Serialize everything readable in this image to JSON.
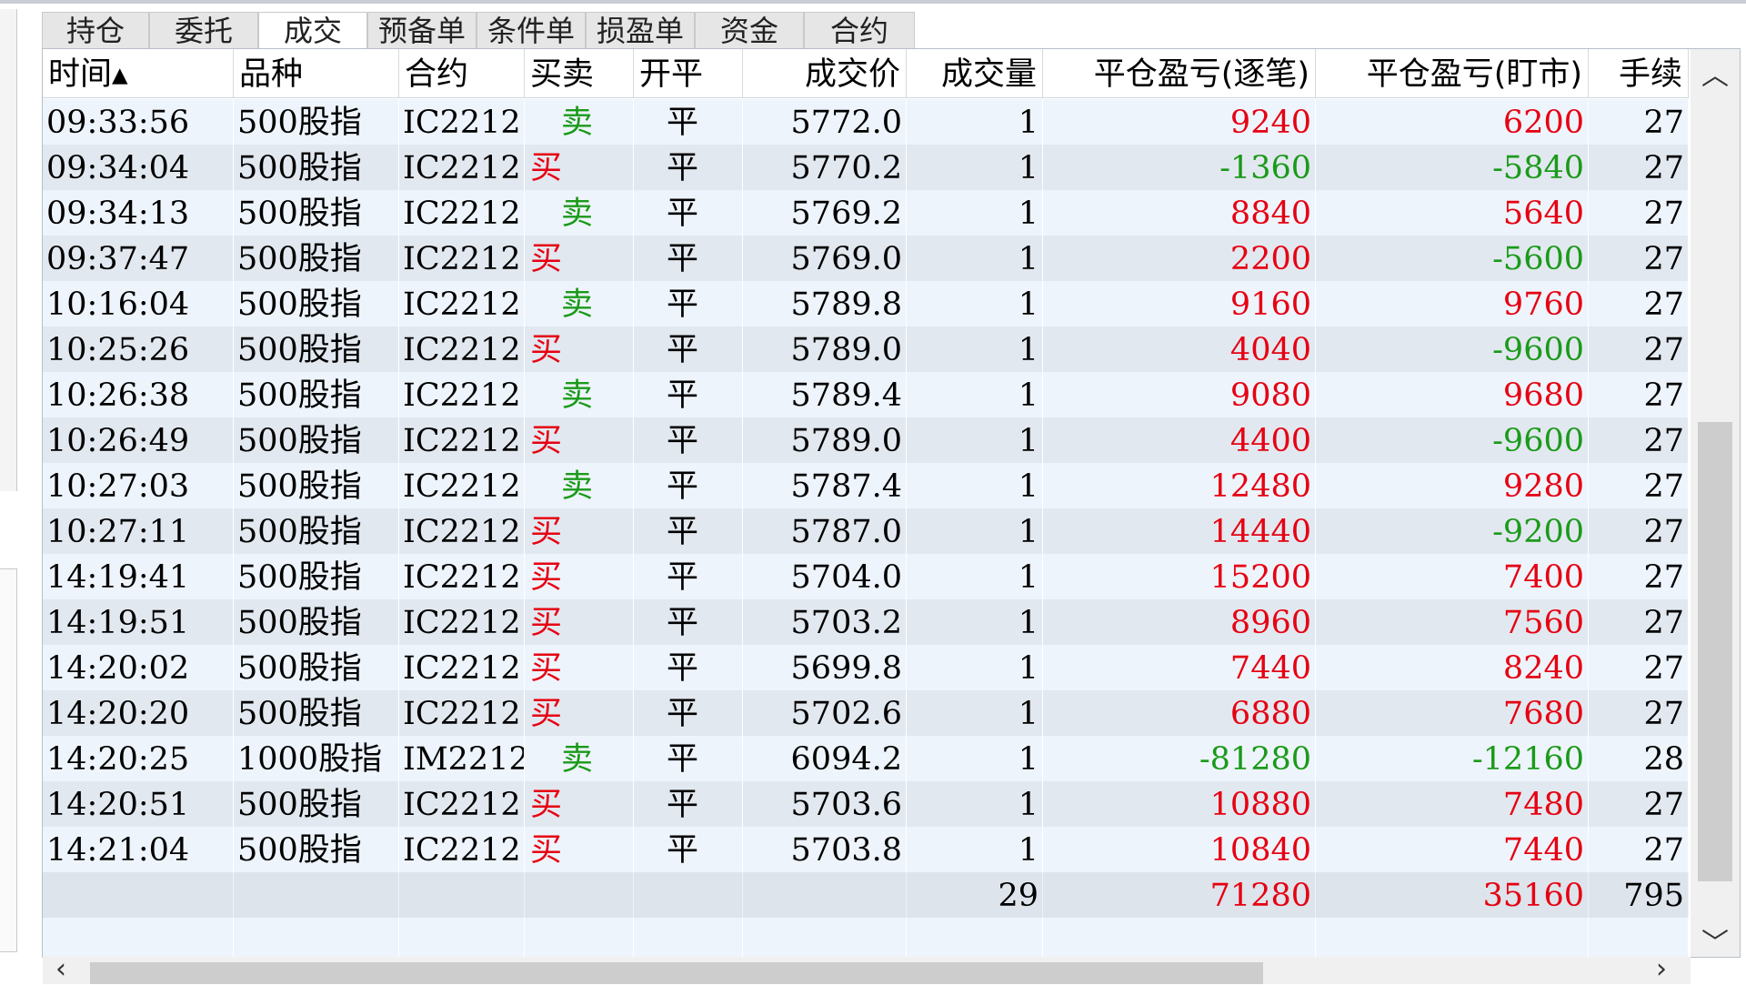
{
  "tabs": [
    {
      "label": "持仓",
      "w": 118
    },
    {
      "label": "委托",
      "w": 120
    },
    {
      "label": "成交",
      "w": 120,
      "active": true
    },
    {
      "label": "预备单",
      "w": 120
    },
    {
      "label": "条件单",
      "w": 120
    },
    {
      "label": "损盈单",
      "w": 120
    },
    {
      "label": "资金",
      "w": 120
    },
    {
      "label": "合约",
      "w": 122
    }
  ],
  "columns": [
    {
      "label": "时间▴",
      "w": 210,
      "align": "l"
    },
    {
      "label": "品种",
      "w": 182,
      "align": "l"
    },
    {
      "label": "合约",
      "w": 138,
      "align": "l"
    },
    {
      "label": "买卖",
      "w": 120,
      "align": "l"
    },
    {
      "label": "开平",
      "w": 120,
      "align": "l"
    },
    {
      "label": "成交价",
      "w": 180,
      "align": "r"
    },
    {
      "label": "成交量",
      "w": 150,
      "align": "r"
    },
    {
      "label": "平仓盈亏(逐笔)",
      "w": 300,
      "align": "r"
    },
    {
      "label": "平仓盈亏(盯市)",
      "w": 300,
      "align": "r"
    },
    {
      "label": "手续",
      "w": 110,
      "align": "r"
    }
  ],
  "rows": [
    {
      "time": "09:33:56",
      "product": "500股指",
      "contract": "IC2212",
      "side": "卖",
      "oc": "平",
      "price": "5772.0",
      "qty": "1",
      "pnl_trade": "9240",
      "pnl_mtm": "6200",
      "fee": "27"
    },
    {
      "time": "09:34:04",
      "product": "500股指",
      "contract": "IC2212",
      "side": "买",
      "oc": "平",
      "price": "5770.2",
      "qty": "1",
      "pnl_trade": "-1360",
      "pnl_mtm": "-5840",
      "fee": "27"
    },
    {
      "time": "09:34:13",
      "product": "500股指",
      "contract": "IC2212",
      "side": "卖",
      "oc": "平",
      "price": "5769.2",
      "qty": "1",
      "pnl_trade": "8840",
      "pnl_mtm": "5640",
      "fee": "27"
    },
    {
      "time": "09:37:47",
      "product": "500股指",
      "contract": "IC2212",
      "side": "买",
      "oc": "平",
      "price": "5769.0",
      "qty": "1",
      "pnl_trade": "2200",
      "pnl_mtm": "-5600",
      "fee": "27"
    },
    {
      "time": "10:16:04",
      "product": "500股指",
      "contract": "IC2212",
      "side": "卖",
      "oc": "平",
      "price": "5789.8",
      "qty": "1",
      "pnl_trade": "9160",
      "pnl_mtm": "9760",
      "fee": "27"
    },
    {
      "time": "10:25:26",
      "product": "500股指",
      "contract": "IC2212",
      "side": "买",
      "oc": "平",
      "price": "5789.0",
      "qty": "1",
      "pnl_trade": "4040",
      "pnl_mtm": "-9600",
      "fee": "27"
    },
    {
      "time": "10:26:38",
      "product": "500股指",
      "contract": "IC2212",
      "side": "卖",
      "oc": "平",
      "price": "5789.4",
      "qty": "1",
      "pnl_trade": "9080",
      "pnl_mtm": "9680",
      "fee": "27"
    },
    {
      "time": "10:26:49",
      "product": "500股指",
      "contract": "IC2212",
      "side": "买",
      "oc": "平",
      "price": "5789.0",
      "qty": "1",
      "pnl_trade": "4400",
      "pnl_mtm": "-9600",
      "fee": "27"
    },
    {
      "time": "10:27:03",
      "product": "500股指",
      "contract": "IC2212",
      "side": "卖",
      "oc": "平",
      "price": "5787.4",
      "qty": "1",
      "pnl_trade": "12480",
      "pnl_mtm": "9280",
      "fee": "27"
    },
    {
      "time": "10:27:11",
      "product": "500股指",
      "contract": "IC2212",
      "side": "买",
      "oc": "平",
      "price": "5787.0",
      "qty": "1",
      "pnl_trade": "14440",
      "pnl_mtm": "-9200",
      "fee": "27"
    },
    {
      "time": "14:19:41",
      "product": "500股指",
      "contract": "IC2212",
      "side": "买",
      "oc": "平",
      "price": "5704.0",
      "qty": "1",
      "pnl_trade": "15200",
      "pnl_mtm": "7400",
      "fee": "27"
    },
    {
      "time": "14:19:51",
      "product": "500股指",
      "contract": "IC2212",
      "side": "买",
      "oc": "平",
      "price": "5703.2",
      "qty": "1",
      "pnl_trade": "8960",
      "pnl_mtm": "7560",
      "fee": "27"
    },
    {
      "time": "14:20:02",
      "product": "500股指",
      "contract": "IC2212",
      "side": "买",
      "oc": "平",
      "price": "5699.8",
      "qty": "1",
      "pnl_trade": "7440",
      "pnl_mtm": "8240",
      "fee": "27"
    },
    {
      "time": "14:20:20",
      "product": "500股指",
      "contract": "IC2212",
      "side": "买",
      "oc": "平",
      "price": "5702.6",
      "qty": "1",
      "pnl_trade": "6880",
      "pnl_mtm": "7680",
      "fee": "27"
    },
    {
      "time": "14:20:25",
      "product": "1000股指",
      "contract": "IM2212",
      "side": "卖",
      "oc": "平",
      "price": "6094.2",
      "qty": "1",
      "pnl_trade": "-81280",
      "pnl_mtm": "-12160",
      "fee": "28"
    },
    {
      "time": "14:20:51",
      "product": "500股指",
      "contract": "IC2212",
      "side": "买",
      "oc": "平",
      "price": "5703.6",
      "qty": "1",
      "pnl_trade": "10880",
      "pnl_mtm": "7480",
      "fee": "27"
    },
    {
      "time": "14:21:04",
      "product": "500股指",
      "contract": "IC2212",
      "side": "买",
      "oc": "平",
      "price": "5703.8",
      "qty": "1",
      "pnl_trade": "10840",
      "pnl_mtm": "7440",
      "fee": "27"
    }
  ],
  "totals": {
    "qty": "29",
    "pnl_trade": "71280",
    "pnl_mtm": "35160",
    "fee": "795"
  },
  "colors": {
    "positive": "#e60012",
    "negative": "#1a9a1a",
    "buy": "#e60012",
    "sell": "#1a9a1a"
  },
  "icons": {
    "scroll_up": "chevron-up-icon",
    "scroll_down": "chevron-down-icon",
    "scroll_left": "chevron-left-icon",
    "scroll_right": "chevron-right-icon"
  }
}
